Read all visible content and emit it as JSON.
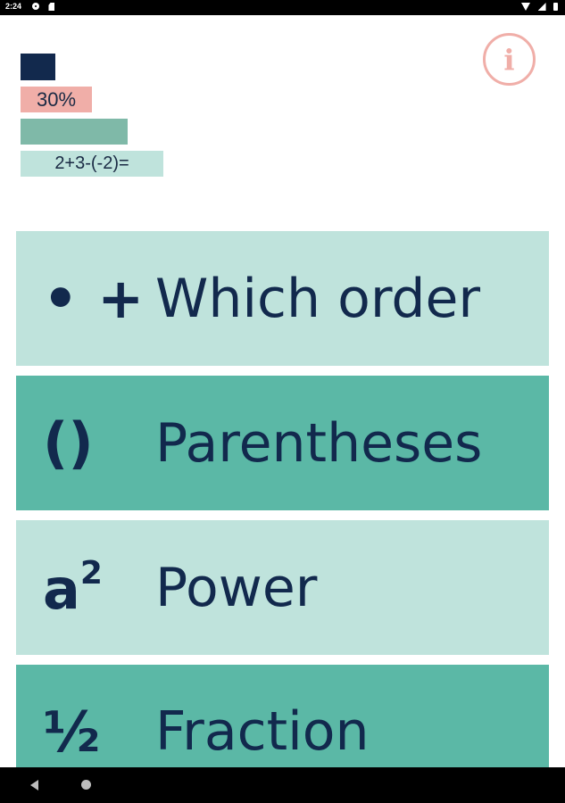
{
  "status_bar": {
    "time": "2:24",
    "left_icons": [
      "gear-icon",
      "sd-card-icon"
    ],
    "right_icons": [
      "wifi-icon",
      "signal-icon",
      "battery-icon"
    ]
  },
  "stats": {
    "percent": "30%",
    "expression": "2+3-(-2)="
  },
  "colors": {
    "navy": "#12294d",
    "pink": "#f0aea8",
    "teal_dark": "#5bb8a6",
    "teal_light": "#bfe3dc",
    "teal_mid": "#7fb9a8"
  },
  "info_button": {
    "icon": "info-icon",
    "glyph": "i"
  },
  "topics": [
    {
      "symbol": "• +",
      "label": "Which order"
    },
    {
      "symbol": "()",
      "label": "Parentheses"
    },
    {
      "symbol_base": "a",
      "symbol_sup": "2",
      "label": "Power"
    },
    {
      "symbol": "½",
      "label": "Fraction"
    }
  ],
  "nav_bar": {
    "icons": [
      "back-icon",
      "home-icon"
    ]
  }
}
